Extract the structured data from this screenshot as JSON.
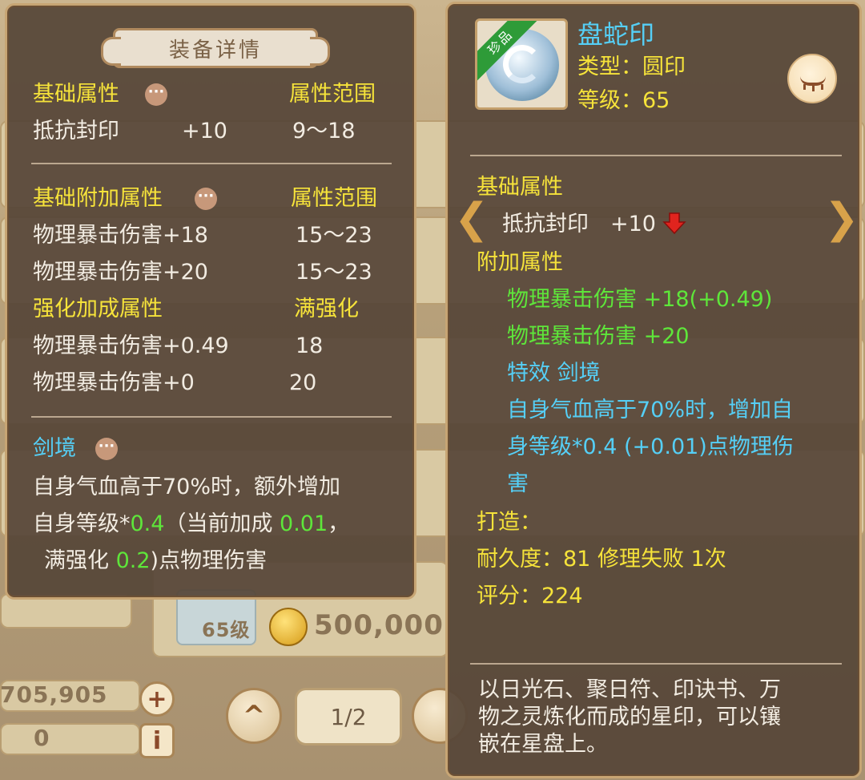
{
  "background": {
    "silver_amount": "705,905",
    "gold_amount": "0",
    "price": "500,000",
    "level_badge": "65级",
    "pager": "1/2",
    "add_icon": "+",
    "info_icon": "i",
    "up_icon": "^"
  },
  "detail_panel": {
    "title": "装备详情",
    "base_attr": {
      "header": "基础属性",
      "range_header": "属性范围",
      "rows": [
        {
          "name": "抵抗封印",
          "value": "+10",
          "range": "9～18"
        }
      ]
    },
    "base_extra_attr": {
      "header": "基础附加属性",
      "range_header": "属性范围",
      "rows": [
        {
          "name": "物理暴击伤害+18",
          "range": "15～23"
        },
        {
          "name": "物理暴击伤害+20",
          "range": "15～23"
        }
      ]
    },
    "enhance_attr": {
      "header": "强化加成属性",
      "range_header": "满强化",
      "rows": [
        {
          "name": "物理暴击伤害+0.49",
          "range": "18"
        },
        {
          "name": "物理暴击伤害+0",
          "range": "20"
        }
      ]
    },
    "effect": {
      "name": "剑境",
      "line1": "自身气血高于70%时，额外增加",
      "line2_a": "自身等级*",
      "line2_b": "0.4",
      "line2_c": "（当前加成 ",
      "line2_d": "0.01",
      "line2_e": "，",
      "line3_a": "满强化 ",
      "line3_b": "0.2",
      "line3_c": ")点物理伤害"
    }
  },
  "item_panel": {
    "rarity": "珍品",
    "name": "盘蛇印",
    "type_line": "类型：圆印",
    "level_line": "等级：65",
    "base_header": "基础属性",
    "base_stat": "抵抗封印　+10",
    "extra_header": "附加属性",
    "extra_stats": [
      "物理暴击伤害 +18(+0.49)",
      "物理暴击伤害 +20"
    ],
    "effect_title": "特效 剑境",
    "effect_desc": [
      "自身气血高于70%时，增加自",
      "身等级*0.4 (+0.01)点物理伤",
      "害"
    ],
    "forge": "打造：",
    "durability": "耐久度：81 修理失败 1次",
    "score": "评分：224",
    "description": [
      "以日光石、聚日符、印诀书、万",
      "物之灵炼化而成的星印，可以镶",
      "嵌在星盘上。"
    ],
    "prev_icon": "❮",
    "next_icon": "❯"
  },
  "colors": {
    "panel_bg": "#564638",
    "header_yellow": "#f6e33a",
    "value_green": "#5ee63a",
    "effect_cyan": "#55cff6"
  }
}
